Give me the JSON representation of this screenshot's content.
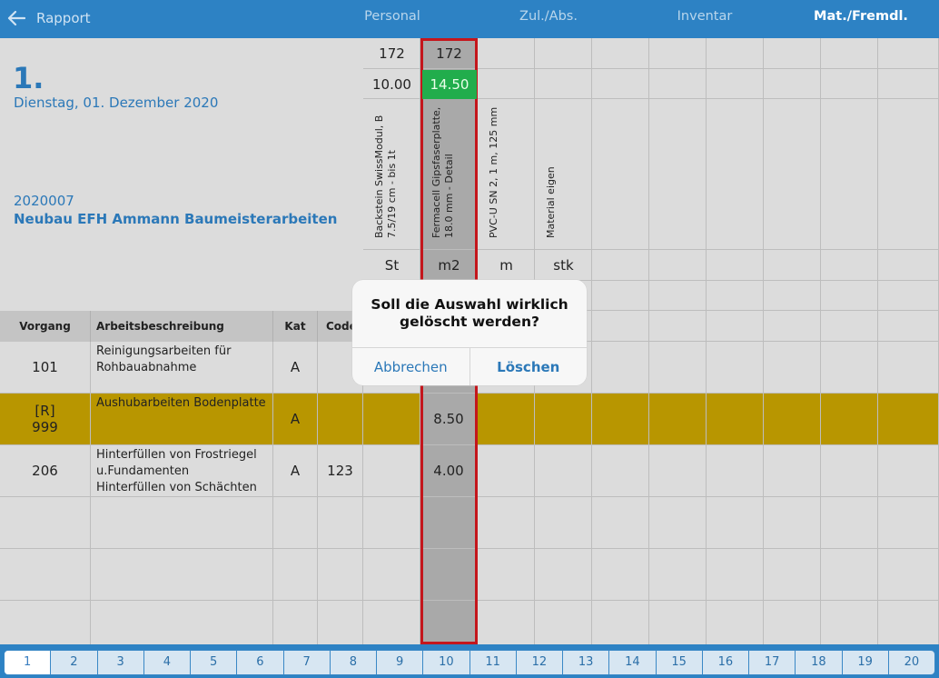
{
  "nav": {
    "back_label": "Rapport",
    "tabs": [
      {
        "label": "Personal"
      },
      {
        "label": "Zul./Abs."
      },
      {
        "label": "Inventar"
      },
      {
        "label": "Mat./Fremdl."
      }
    ]
  },
  "header": {
    "day": "1.",
    "date": "Dienstag, 01. Dezember 2020",
    "project_no": "2020007",
    "project_name": "Neubau EFH Ammann Baumeisterarbeiten"
  },
  "materials": {
    "codes": [
      "172",
      "172"
    ],
    "values": [
      "10.00",
      "14.50"
    ],
    "names": [
      "Backstein SwissModul, B\n7.5/19 cm - bis 1t",
      "Fermacell Gipsfaserplatte,\n18.0 mm - Detail",
      "PVC-U SN 2, 1 m, 125 mm",
      "Material eigen"
    ],
    "units": [
      "St",
      "m2",
      "m",
      "stk"
    ]
  },
  "table": {
    "headers": [
      "Vorgang",
      "Arbeitsbeschreibung",
      "Kat",
      "Code"
    ],
    "rows": [
      {
        "vorgang": "101",
        "desc": "Reinigungsarbeiten für\nRohbauabnahme",
        "kat": "A",
        "code": "",
        "m2": ""
      },
      {
        "vorgang": "[R]\n999",
        "desc": "Aushubarbeiten Bodenplatte",
        "kat": "A",
        "code": "",
        "m2": "8.50"
      },
      {
        "vorgang": "206",
        "desc": "Hinterfüllen von Frostriegel\nu.Fundamenten\nHinterfüllen von Schächten",
        "kat": "A",
        "code": "123",
        "m2": "4.00"
      }
    ]
  },
  "dialog": {
    "message": "Soll die Auswahl wirklich\ngelöscht werden?",
    "cancel": "Abbrechen",
    "confirm": "Löschen"
  },
  "pager": {
    "pages": [
      "1",
      "2",
      "3",
      "4",
      "5",
      "6",
      "7",
      "8",
      "9",
      "10",
      "11",
      "12",
      "13",
      "14",
      "15",
      "16",
      "17",
      "18",
      "19",
      "20"
    ],
    "active": "1"
  },
  "colors": {
    "nav_bg": "#2d82c4",
    "accent_text": "#2b78b8",
    "highlight_row": "#b89600",
    "selection_border": "#c4161c",
    "green_value": "#21ad4c"
  }
}
